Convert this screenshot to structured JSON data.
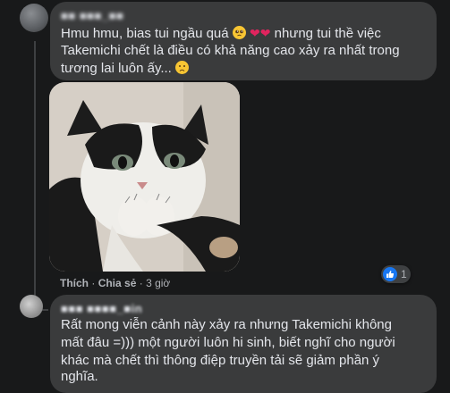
{
  "comment1": {
    "author": "■■ ■■■_■■",
    "text_line1": "Hmu hmu, bias tui ngầu quá",
    "text_line1b": "nhưng tui thề việc",
    "text_line2": "Takemichi chết là điều có khả năng cao xảy ra nhất trong",
    "text_line3": "tương lai luôn ấy...",
    "emoji_1": "pleading-face",
    "emoji_2": "red-heart",
    "emoji_3": "red-heart",
    "emoji_4": "worried-face",
    "actions": {
      "like": "Thích",
      "reply": "Chia sẻ",
      "separator": "·",
      "time": "3 giờ"
    },
    "reaction": {
      "icon": "like",
      "count": "1"
    },
    "image_alt": "crying cat meme"
  },
  "comment2": {
    "author": "■■■ ■■■■_■in",
    "text_line1": "Rất mong viễn cảnh này xảy ra nhưng Takemichi không",
    "text_line2": "mất đâu =))) một người luôn hi sinh, biết nghĩ cho người",
    "text_line3": "khác mà chết thì thông điệp truyền tải sẽ giảm phần ý",
    "text_line4": "nghĩa."
  },
  "colors": {
    "background": "#18191a",
    "bubble": "#3a3b3c",
    "text": "#e4e6eb",
    "secondary": "#b0b3b8",
    "like_blue": "#1877f2"
  }
}
